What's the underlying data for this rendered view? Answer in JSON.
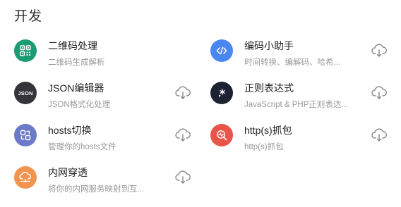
{
  "section": {
    "title": "开发"
  },
  "colors": {
    "qr": "#1a9b72",
    "encoder": "#4a86f0",
    "json": "#34343a",
    "regex": "#1d2233",
    "hosts": "#6b79c9",
    "http": "#e8544a",
    "tunnel": "#f0944f",
    "download": "#888888"
  },
  "tools": [
    {
      "title": "二维码处理",
      "desc": "二维码生成解析",
      "icon": "qr-code-icon"
    },
    {
      "title": "编码小助手",
      "desc": "时间转换、编解码、哈希...",
      "icon": "code-icon"
    },
    {
      "title": "JSON编辑器",
      "desc": "JSON格式化处理",
      "icon": "json-icon",
      "icon_text": "JSON"
    },
    {
      "title": "正则表达式",
      "desc": "JavaScript & PHP正则表达...",
      "icon": "regex-icon"
    },
    {
      "title": "hosts切换",
      "desc": "管理你的hosts文件",
      "icon": "hosts-switch-icon"
    },
    {
      "title": "http(s)抓包",
      "desc": "http(s)抓包",
      "icon": "packet-capture-icon"
    },
    {
      "title": "内网穿透",
      "desc": "将你的内网服务映射到互...",
      "icon": "cloud-tunnel-icon"
    }
  ]
}
